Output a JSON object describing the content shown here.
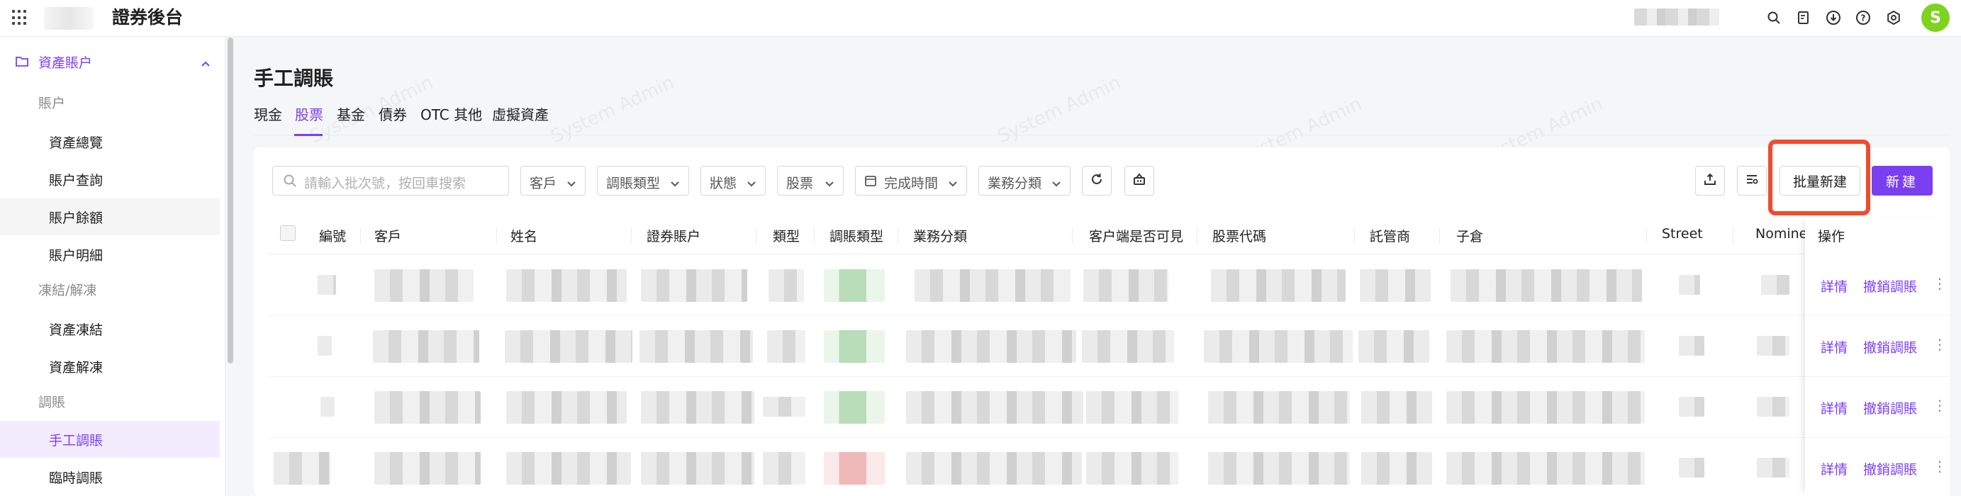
{
  "app": {
    "title": "證券後台",
    "avatar_initial": "S"
  },
  "header_icons": [
    "search-icon",
    "document-icon",
    "download-icon",
    "help-icon",
    "settings-icon"
  ],
  "sidebar": {
    "group_label": "資產賬户",
    "sections": [
      {
        "label": "賬户",
        "items": [
          "資產總覽",
          "賬户查詢",
          "賬户餘額",
          "賬户明細"
        ]
      },
      {
        "label": "凍結/解凍",
        "items": [
          "資產凍結",
          "資產解凍"
        ]
      },
      {
        "label": "調賬",
        "items": [
          "手工調賬",
          "臨時調賬"
        ]
      }
    ],
    "active_item": "手工調賬"
  },
  "page": {
    "title": "手工調賬",
    "tabs": [
      "現金",
      "股票",
      "基金",
      "債券",
      "OTC 其他",
      "虛擬資產"
    ],
    "active_tab": "股票"
  },
  "toolbar": {
    "search_placeholder": "請輸入批次號，按回車搜索",
    "filters": [
      "客戶",
      "調賬類型",
      "狀態",
      "股票",
      "完成時間",
      "業務分類"
    ],
    "batch_create_label": "批量新建",
    "create_label": "新建"
  },
  "table": {
    "columns": [
      "編號",
      "客戶",
      "姓名",
      "證券賬户",
      "類型",
      "調賬類型",
      "業務分類",
      "客户端是否可見",
      "股票代碼",
      "託管商",
      "子倉",
      "Street",
      "Nomine",
      "操作"
    ],
    "row_actions": {
      "detail": "詳情",
      "revoke": "撤銷調賬",
      "more": "⋮"
    },
    "row_count": 4
  },
  "watermark": "System Admin",
  "colors": {
    "accent": "#7b3ff2",
    "highlight": "#f24a2f",
    "avatar": "#7ed321"
  }
}
